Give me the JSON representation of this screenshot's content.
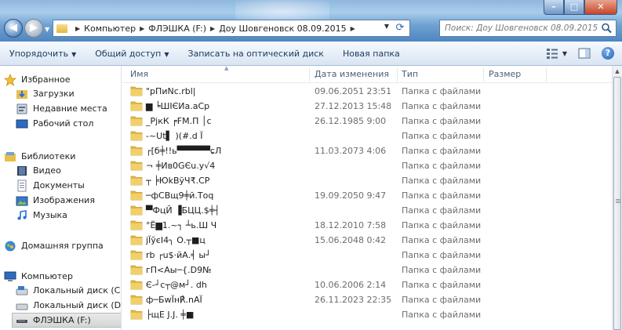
{
  "window": {
    "buttons": {
      "minimize": "–",
      "maximize": "□",
      "close": "✕"
    }
  },
  "nav": {
    "back": "◀",
    "forward": "▶"
  },
  "address": {
    "crumbs": [
      "Компьютер",
      "ФЛЭШКА (F:)",
      "Доу Шовгеновск 08.09.2015"
    ]
  },
  "search": {
    "placeholder": "Поиск: Доу Шовгеновск 08.09.2015"
  },
  "toolbar": {
    "organize": "Упорядочить",
    "share": "Общий доступ",
    "burn": "Записать на оптический диск",
    "new_folder": "Новая папка"
  },
  "sidebar": {
    "favorites": {
      "label": "Избранное",
      "items": [
        {
          "label": "Загрузки",
          "icon": "downloads-folder-icon"
        },
        {
          "label": "Недавние места",
          "icon": "recent-places-icon"
        },
        {
          "label": "Рабочий стол",
          "icon": "desktop-icon"
        }
      ]
    },
    "libraries": {
      "label": "Библиотеки",
      "items": [
        {
          "label": "Видео",
          "icon": "video-library-icon"
        },
        {
          "label": "Документы",
          "icon": "documents-library-icon"
        },
        {
          "label": "Изображения",
          "icon": "pictures-library-icon"
        },
        {
          "label": "Музыка",
          "icon": "music-library-icon"
        }
      ]
    },
    "homegroup": {
      "label": "Домашняя группа"
    },
    "computer": {
      "label": "Компьютер",
      "items": [
        {
          "label": "Локальный диск (C"
        },
        {
          "label": "Локальный диск (D"
        },
        {
          "label": "ФЛЭШКА (F:)"
        }
      ]
    }
  },
  "columns": {
    "name": "Имя",
    "date": "Дата изменения",
    "type": "Тип",
    "size": "Размер"
  },
  "files": [
    {
      "name": "\"рПиNс.rbl|",
      "date": "09.06.2051 23:51",
      "type": "Папка с файлами"
    },
    {
      "name": "▆ ╘ШІЄИа.аСр",
      "date": "27.12.2013 15:48",
      "type": "Папка с файлами"
    },
    {
      "name": "_РjкК ╒FM.П │с",
      "date": "26.12.1985 9:00",
      "type": "Папка с файлами"
    },
    {
      "name": "-~Ut▌ )(#.d Ї",
      "date": "",
      "type": "Папка с файлами"
    },
    {
      "name": "┌[б╪!!ь▀▀▀▀▀ɕЛ",
      "date": "11.03.2073 4:06",
      "type": "Папка с файлами"
    },
    {
      "name": "¬ ╪Ив0GЄu.у√4",
      "date": "",
      "type": "Папка с файлами"
    },
    {
      "name": "┬ ╞ЮkВўЧ₹.СР",
      "date": "",
      "type": "Папка с файлами"
    },
    {
      "name": "─фСВщ9╪й.Тоq",
      "date": "19.09.2050 9:47",
      "type": "Папка с файлами"
    },
    {
      "name": "▀ФцЙ ▐БЦЦ.$╪┤",
      "date": "",
      "type": "Папка с файлами"
    },
    {
      "name": "°Ё▆1.~┐ ┴ь.Ш Ч",
      "date": "18.12.2010 7:58",
      "type": "Папка с файлами"
    },
    {
      "name": "jЇўєІ4╮ О.┬■ц",
      "date": "15.06.2048 0:42",
      "type": "Папка с файлами"
    },
    {
      "name": "rb ┌u$·йА.╡ ы┘",
      "date": "",
      "type": "Папка с файлами"
    },
    {
      "name": "гП<Аы─{.D9№",
      "date": "",
      "type": "Папка с файлами"
    },
    {
      "name": "Є-┘с┬@м┘.   dh",
      "date": "10.06.2006 2:14",
      "type": "Папка с файлами"
    },
    {
      "name": "ф─БwЇн℟.nАЇ",
      "date": "26.11.2023 22:35",
      "type": "Папка с файлами"
    },
    {
      "name": "├щЕ J.J. ╪■",
      "date": "",
      "type": "Папка с файлами"
    }
  ],
  "colors": {
    "title_gradient_top": "#a9cdeb",
    "title_gradient_bottom": "#4f86c0",
    "toolbar_text": "#1e395b",
    "folder_yellow": "#e8bf4c",
    "secondary_text": "#6d6d6d"
  }
}
